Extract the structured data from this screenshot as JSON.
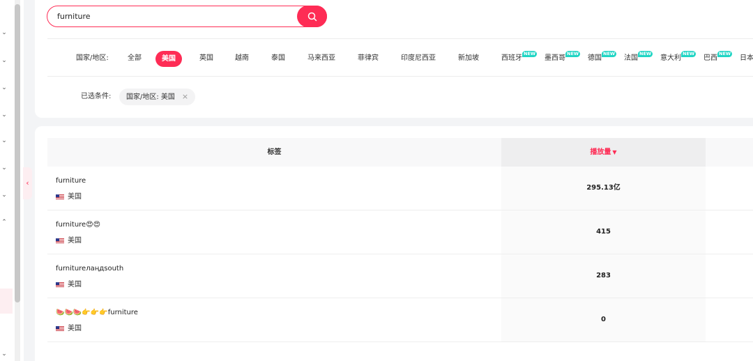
{
  "search": {
    "value": "furniture"
  },
  "filters": {
    "region_label": "国家/地区:",
    "options": [
      {
        "label": "全部",
        "active": false,
        "is_new": false
      },
      {
        "label": "美国",
        "active": true,
        "is_new": false
      },
      {
        "label": "英国",
        "active": false,
        "is_new": false
      },
      {
        "label": "越南",
        "active": false,
        "is_new": false
      },
      {
        "label": "泰国",
        "active": false,
        "is_new": false
      },
      {
        "label": "马来西亚",
        "active": false,
        "is_new": false
      },
      {
        "label": "菲律宾",
        "active": false,
        "is_new": false
      },
      {
        "label": "印度尼西亚",
        "active": false,
        "is_new": false
      },
      {
        "label": "新加坡",
        "active": false,
        "is_new": false
      },
      {
        "label": "西班牙",
        "active": false,
        "is_new": true
      },
      {
        "label": "墨西哥",
        "active": false,
        "is_new": true
      },
      {
        "label": "德国",
        "active": false,
        "is_new": true
      },
      {
        "label": "法国",
        "active": false,
        "is_new": true
      },
      {
        "label": "意大利",
        "active": false,
        "is_new": true
      },
      {
        "label": "巴西",
        "active": false,
        "is_new": true
      },
      {
        "label": "日本",
        "active": false,
        "is_new": false
      }
    ],
    "new_badge": "NEW",
    "selected_label": "已选条件:",
    "selected_chip": "国家/地区: 美国",
    "chip_close": "×"
  },
  "table": {
    "header_tag": "标签",
    "header_views": "播放量",
    "rows": [
      {
        "tag": "furniture",
        "country": "美国",
        "views": "295.13亿"
      },
      {
        "tag": "furniture😍😍",
        "country": "美国",
        "views": "415"
      },
      {
        "tag": "furnitureлаңдsouth",
        "country": "美国",
        "views": "283"
      },
      {
        "tag": "🍉🍉🍉👉👉👉furniture",
        "country": "美国",
        "views": "0"
      }
    ]
  },
  "colors": {
    "accent": "#fe2c55",
    "new_badge": "#20d5c4"
  }
}
